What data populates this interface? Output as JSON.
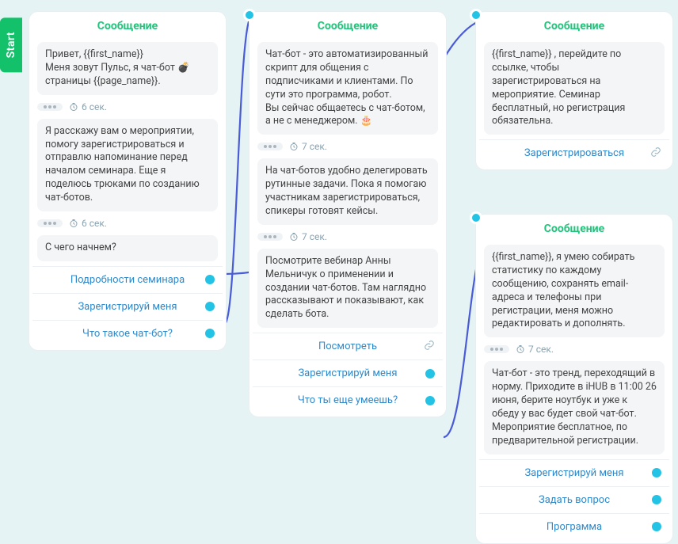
{
  "start_label": "Start",
  "delay_prefix": "6 сек.",
  "cards": [
    {
      "title": "Сообщение",
      "msg1": "Привет, {{first_name}}\nМеня зовут Пульс, я чат-бот 💣 страницы {{page_name}}.",
      "delay1": "6 сек.",
      "msg2": "Я расскажу вам о мероприятии, помогу зарегистрироваться и отправлю напоминание перед началом семинара. Еще я поделюсь трюками по созданию чат-ботов.",
      "delay2": "6 сек.",
      "msg3": "С чего начнем?",
      "choices": [
        "Подробности семинара",
        "Зарегистрируй меня",
        "Что такое чат-бот?"
      ]
    },
    {
      "title": "Сообщение",
      "msg1": "Чат-бот - это автоматизированный скрипт для общения с подписчиками и клиентами. По сути это программа, робот.\nВы сейчас общаетесь с чат-ботом, а не с менеджером. 🎂",
      "delay1": "7 сек.",
      "msg2": "На чат-ботов удобно делегировать рутинные задачи. Пока я помогаю участникам зарегистрироваться, спикеры готовят кейсы.",
      "delay2": "7 сек.",
      "msg3": "Посмотрите вебинар Анны Мельничук о применении и создании чат-ботов. Там наглядно рассказывают и показывают, как сделать бота.",
      "choices": [
        "Посмотреть",
        "Зарегистрируй меня",
        "Что ты еще умеешь?"
      ]
    },
    {
      "title": "Сообщение",
      "msg1": "{{first_name}} , перейдите по ссылке, чтобы зарегистрироваться на мероприятие. Семинар бесплатный, но регистрация обязательна.",
      "choices": [
        "Зарегистрироваться"
      ]
    },
    {
      "title": "Сообщение",
      "msg1": "{{first_name}}, я умею собирать статистику по каждому сообщению, сохранять email-адреса и телефоны при регистрации, меня можно редактировать и дополнять.",
      "delay1": "7 сек.",
      "msg2": "Чат-бот - это тренд, переходящий в норму. Приходите в iHUB в 11:00 26 июня, берите ноутбук и уже к обеду у вас будет свой чат-бот. Мероприятие бесплатное, по предварительной регистрации.",
      "choices": [
        "Зарегистрируй меня",
        "Задать вопрос",
        "Программа"
      ]
    }
  ]
}
